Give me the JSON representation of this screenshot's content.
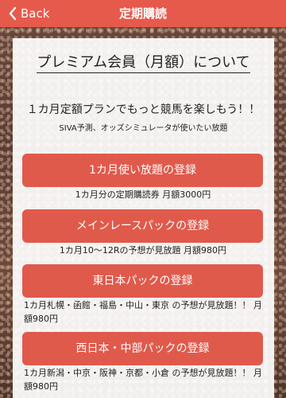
{
  "nav": {
    "back_label": "Back",
    "title": "定期購読"
  },
  "page": {
    "heading": "プレミアム会員（月額）について",
    "tagline": "１カ月定額プランでもっと競馬を楽しもう！！",
    "subnote": "SIVA予測、オッズシミュレータが使いたい放題"
  },
  "plans": [
    {
      "button_label": "1カ月使い放題の登録",
      "description": "1カ月分の定期購読券 月額3000円"
    },
    {
      "button_label": "メインレースパックの登録",
      "description": "1カ月10〜12Rの予想が見放題 月額980円"
    },
    {
      "button_label": "東日本パックの登録",
      "description": "1カ月札幌・函館・福島・中山・東京 の予想が見放題！！ 月額980円"
    },
    {
      "button_label": "西日本・中部パックの登録",
      "description": "1カ月新潟・中京・阪神・京都・小倉 の予想が見放題！！ 月額980円"
    }
  ],
  "colors": {
    "nav_bar": "#e65a4c",
    "button": "#e05a4c"
  }
}
